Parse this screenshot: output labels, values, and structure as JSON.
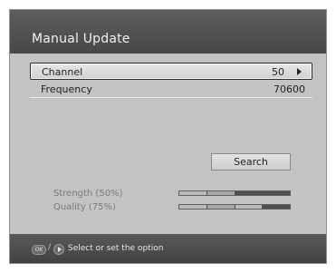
{
  "header": {
    "title": "Manual Update"
  },
  "fields": {
    "channel": {
      "label": "Channel",
      "value": "50"
    },
    "frequency": {
      "label": "Frequency",
      "value": "70600"
    }
  },
  "search_button": {
    "label": "Search"
  },
  "signal": {
    "strength": {
      "label": "Strength (50%)",
      "level_percent": 50
    },
    "quality": {
      "label": "Quality (75%)",
      "level_percent": 75
    }
  },
  "footer": {
    "ok_key": "OK",
    "separator": "/",
    "hint": "Select or set the option"
  },
  "colors": {
    "panel_background": "#c3c3c3",
    "bar_filled": "#b9b9b9",
    "bar_empty": "#4f4f4f"
  },
  "icons": {
    "channel_arrow": "right-arrow-icon",
    "ok_key": "ok-key-icon",
    "right_key": "right-key-icon"
  }
}
